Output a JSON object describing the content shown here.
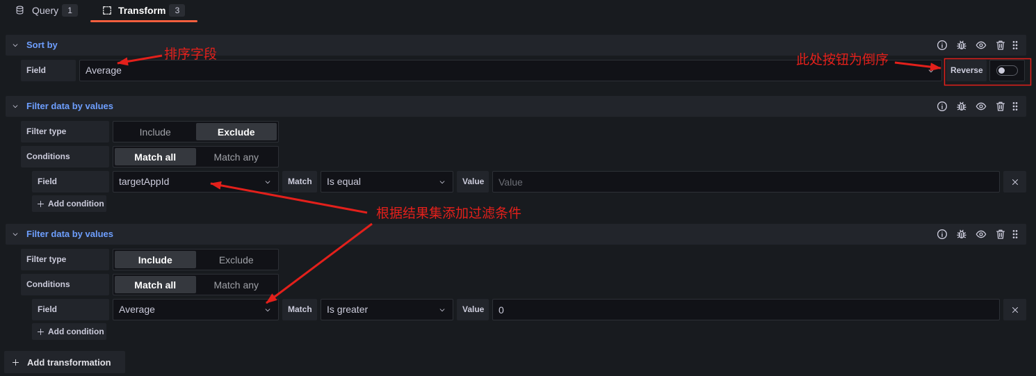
{
  "tabs": [
    {
      "label": "Query",
      "count": "1",
      "icon": "database-icon"
    },
    {
      "label": "Transform",
      "count": "3",
      "icon": "transform-icon",
      "active": true
    }
  ],
  "header_actions": [
    "info-icon",
    "bug-icon",
    "eye-icon",
    "trash-icon",
    "drag-handle-icon"
  ],
  "transformations": [
    {
      "title": "Sort by",
      "field_label": "Field",
      "field_value": "Average",
      "reverse_label": "Reverse",
      "reverse": false
    },
    {
      "title": "Filter data by values",
      "filter_type_label": "Filter type",
      "filter_type_options": [
        {
          "label": "Include",
          "selected": false
        },
        {
          "label": "Exclude",
          "selected": true
        }
      ],
      "conditions_label": "Conditions",
      "conditions_options": [
        {
          "label": "Match all",
          "selected": true
        },
        {
          "label": "Match any",
          "selected": false
        }
      ],
      "condition": {
        "field_label": "Field",
        "field_value": "targetAppId",
        "match_label": "Match",
        "match_value": "Is equal",
        "value_label": "Value",
        "value_placeholder": "Value"
      },
      "add_condition_label": "Add condition"
    },
    {
      "title": "Filter data by values",
      "filter_type_label": "Filter type",
      "filter_type_options": [
        {
          "label": "Include",
          "selected": true
        },
        {
          "label": "Exclude",
          "selected": false
        }
      ],
      "conditions_label": "Conditions",
      "conditions_options": [
        {
          "label": "Match all",
          "selected": true
        },
        {
          "label": "Match any",
          "selected": false
        }
      ],
      "condition": {
        "field_label": "Field",
        "field_value": "Average",
        "match_label": "Match",
        "match_value": "Is greater",
        "value_label": "Value",
        "value": "0"
      },
      "add_condition_label": "Add condition"
    }
  ],
  "add_transformation_label": "Add transformation",
  "annotations": {
    "sort_field_note": "排序字段",
    "reverse_note": "此处按钮为倒序",
    "filter_note": "根据结果集添加过滤条件"
  },
  "colors": {
    "background": "#181b1f",
    "input_background": "#111217",
    "secondary": "#22252b",
    "title_blue": "#6e9fff",
    "tab_underline": "#f55f3e",
    "annotation_red": "#e3201b"
  }
}
